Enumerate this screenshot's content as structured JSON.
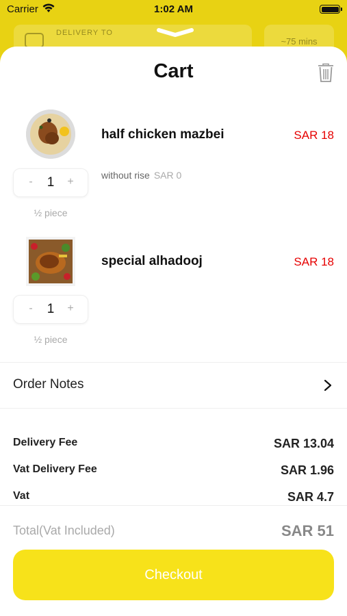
{
  "status_bar": {
    "carrier": "Carrier",
    "time": "1:02 AM"
  },
  "background_header": {
    "delivery_label": "DELIVERY TO",
    "time_label": "~75 mins"
  },
  "cart": {
    "title": "Cart",
    "items": [
      {
        "name": "half chicken mazbei",
        "price": "SAR 18",
        "option": "without rise",
        "option_price": "SAR 0",
        "quantity": "1",
        "portion": "½ piece",
        "image": "chicken-rice-plate"
      },
      {
        "name": "special alhadooj",
        "price": "SAR 18",
        "quantity": "1",
        "portion": "½ piece",
        "image": "grilled-chicken-platter"
      }
    ],
    "stepper": {
      "minus": "-",
      "plus": "+"
    }
  },
  "order_notes": {
    "label": "Order Notes"
  },
  "fees": [
    {
      "label": "Delivery Fee",
      "value": "SAR 13.04"
    },
    {
      "label": "Vat Delivery Fee",
      "value": "SAR 1.96"
    },
    {
      "label": "Vat",
      "value": "SAR 4.7"
    }
  ],
  "total": {
    "label": "Total",
    "sublabel": "(Vat Included)",
    "value": "SAR 51"
  },
  "checkout": {
    "label": "Checkout"
  },
  "colors": {
    "accent": "#f7e21a",
    "price": "#e60000",
    "muted": "#a9a9a9"
  }
}
